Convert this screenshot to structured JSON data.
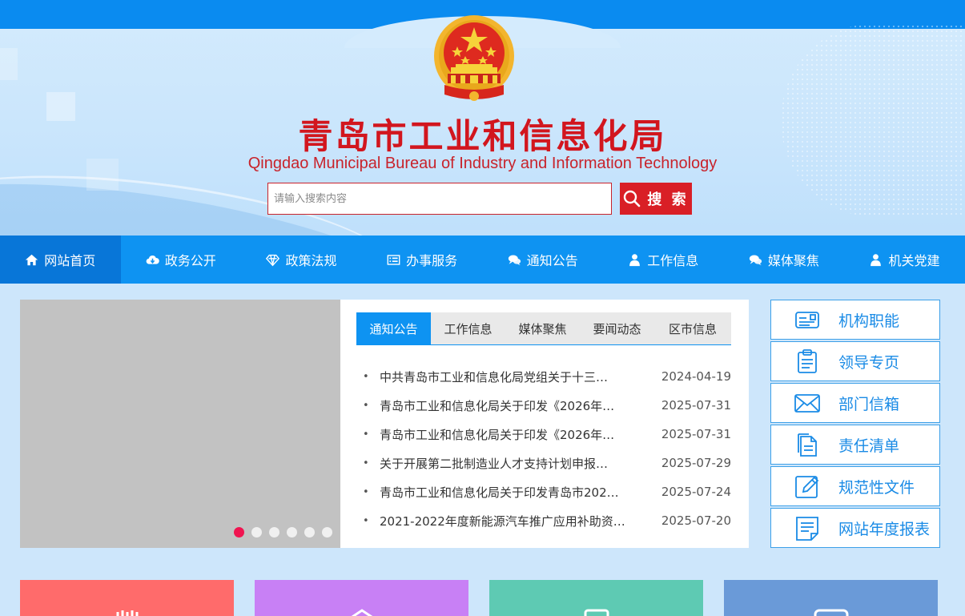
{
  "header": {
    "title": "青岛市工业和信息化局",
    "subtitle": "Qingdao Municipal Bureau of Industry and Information Technology",
    "emblem_icon": "national-emblem-icon"
  },
  "search": {
    "placeholder": "请输入搜索内容",
    "button_label": "搜 索"
  },
  "nav": {
    "items": [
      {
        "label": "网站首页",
        "icon": "home-icon"
      },
      {
        "label": "政务公开",
        "icon": "cloud-download-icon"
      },
      {
        "label": "政策法规",
        "icon": "diamond-icon"
      },
      {
        "label": "办事服务",
        "icon": "list-icon"
      },
      {
        "label": "通知公告",
        "icon": "comments-icon"
      },
      {
        "label": "工作信息",
        "icon": "user-icon"
      },
      {
        "label": "媒体聚焦",
        "icon": "comments-icon"
      },
      {
        "label": "机关党建",
        "icon": "user-icon"
      }
    ]
  },
  "news": {
    "tabs": [
      "通知公告",
      "工作信息",
      "媒体聚焦",
      "要闻动态",
      "区市信息"
    ],
    "items": [
      {
        "title": "中共青岛市工业和信息化局党组关于十三…",
        "date": "2024-04-19"
      },
      {
        "title": "青岛市工业和信息化局关于印发《2026年…",
        "date": "2025-07-31"
      },
      {
        "title": "青岛市工业和信息化局关于印发《2026年…",
        "date": "2025-07-31"
      },
      {
        "title": "关于开展第二批制造业人才支持计划申报…",
        "date": "2025-07-29"
      },
      {
        "title": "青岛市工业和信息化局关于印发青岛市202…",
        "date": "2025-07-24"
      },
      {
        "title": "2021-2022年度新能源汽车推广应用补助资…",
        "date": "2025-07-20"
      }
    ]
  },
  "slider": {
    "slide_count": 6,
    "active_index": 0,
    "active_color": "#f01450"
  },
  "quick_links": [
    {
      "label": "机构职能",
      "icon": "id-card-icon"
    },
    {
      "label": "领导专页",
      "icon": "clipboard-icon"
    },
    {
      "label": "部门信箱",
      "icon": "envelope-icon"
    },
    {
      "label": "责任清单",
      "icon": "document-copy-icon"
    },
    {
      "label": "规范性文件",
      "icon": "edit-icon"
    },
    {
      "label": "网站年度报表",
      "icon": "report-icon"
    }
  ],
  "tiles": [
    {
      "icon": "hands-icon",
      "color": "#ff6b6b"
    },
    {
      "icon": "house-icon",
      "color": "#c880f5"
    },
    {
      "icon": "monitor-icon",
      "color": "#5ecab3"
    },
    {
      "icon": "chat-box-icon",
      "color": "#6a9ad8"
    }
  ],
  "colors": {
    "primary_blue": "#0e93f2",
    "title_red": "#d2161e",
    "search_red": "#d91f26"
  }
}
